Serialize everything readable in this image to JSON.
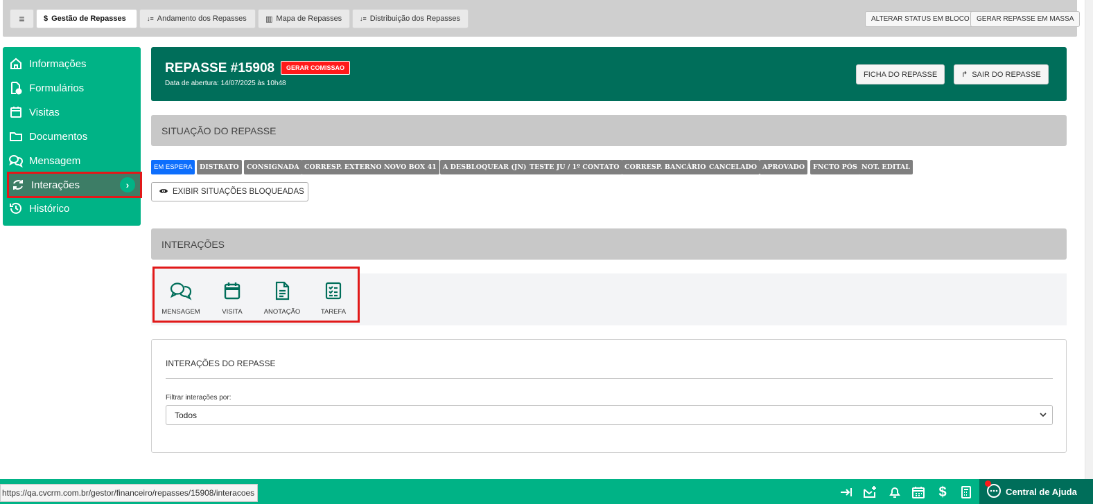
{
  "topbar": {
    "menu_icon": "hamburger-icon",
    "tabs": [
      {
        "label": "Gestão de Repasses",
        "icon": "dollar-icon",
        "glyph": "$"
      },
      {
        "label": "Andamento dos Repasses",
        "icon": "sort-icon",
        "glyph": "↓≡"
      },
      {
        "label": "Mapa de Repasses",
        "icon": "map-icon",
        "glyph": "▥"
      },
      {
        "label": "Distribuição dos Repasses",
        "icon": "sort-icon",
        "glyph": "↓≡"
      }
    ],
    "buttons": {
      "status_block": "ALTERAR STATUS EM BLOCO",
      "bulk_repasse": "GERAR REPASSE EM MASSA"
    }
  },
  "sidebar": {
    "items": [
      {
        "label": "Informações",
        "icon": "home-icon"
      },
      {
        "label": "Formulários",
        "icon": "form-icon"
      },
      {
        "label": "Visitas",
        "icon": "calendar-icon"
      },
      {
        "label": "Documentos",
        "icon": "folder-icon"
      },
      {
        "label": "Mensagem",
        "icon": "chat-icon"
      },
      {
        "label": "Interações",
        "icon": "refresh-icon",
        "active": true
      },
      {
        "label": "Histórico",
        "icon": "history-icon"
      }
    ]
  },
  "header": {
    "title": "REPASSE #15908",
    "badge": "GERAR COMISSAO",
    "subtitle": "Data de abertura: 14/07/2025 às 10h48",
    "ficha_button": "FICHA DO REPASSE",
    "exit_button": "SAIR DO REPASSE"
  },
  "situacao": {
    "title": "SITUAÇÃO DO REPASSE",
    "chips": [
      {
        "label": "EM ESPERA",
        "color": "#0d6efd"
      },
      {
        "label": "DISTRATO",
        "color": "#7f7f7f"
      },
      {
        "label": "CONSIGNADA",
        "color": "#7f7f7f"
      },
      {
        "label": "CORRESP. EXTERNO",
        "color": "#7f7f7f"
      },
      {
        "label": "NOVO BOX 41",
        "color": "#7f7f7f"
      },
      {
        "label": "A DESBLOQUEAR (JN)",
        "color": "#7f7f7f"
      },
      {
        "label": "TESTE JU / 1º CONTATO",
        "color": "#7f7f7f"
      },
      {
        "label": "CORRESP. BANCÁRIO",
        "color": "#7f7f7f"
      },
      {
        "label": "CANCELADO",
        "color": "#7f7f7f"
      },
      {
        "label": "APROVADO",
        "color": "#7f7f7f"
      },
      {
        "label": "FNCTO PÓS",
        "color": "#7f7f7f"
      },
      {
        "label": "NOT. EDITAL",
        "color": "#7f7f7f"
      }
    ],
    "show_blocked": "EXIBIR SITUAÇÕES BLOQUEADAS"
  },
  "interacoes": {
    "title": "INTERAÇÕES",
    "actions": [
      {
        "label": "MENSAGEM",
        "icon": "chat-icon"
      },
      {
        "label": "VISITA",
        "icon": "calendar-icon"
      },
      {
        "label": "ANOTAÇÃO",
        "icon": "document-icon"
      },
      {
        "label": "TAREFA",
        "icon": "checklist-icon"
      }
    ]
  },
  "interacoes_repasse": {
    "title": "INTERAÇÕES DO REPASSE",
    "filter_label": "Filtrar interações por:",
    "filter_value": "Todos"
  },
  "footer": {
    "url": "https://qa.cvcrm.com.br/gestor/financeiro/repasses/15908/interacoes",
    "help_label": "Central de Ajuda"
  },
  "colors": {
    "brand_green": "#00b386",
    "dark_green": "#006e5a",
    "highlight_red": "#e11919",
    "chip_gray": "#7f7f7f",
    "chip_blue": "#0d6efd"
  }
}
